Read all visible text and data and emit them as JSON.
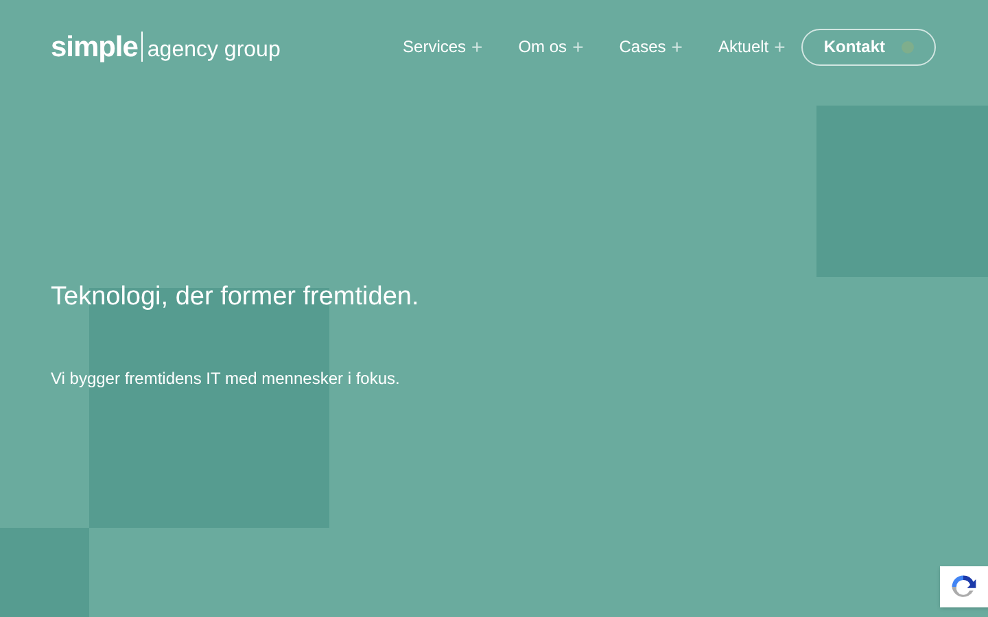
{
  "logo": {
    "primary": "simple",
    "secondary": "agency group"
  },
  "nav": [
    {
      "label": "Services",
      "symbol": "+"
    },
    {
      "label": "Om os",
      "symbol": "+"
    },
    {
      "label": "Cases",
      "symbol": "+"
    },
    {
      "label": "Aktuelt",
      "symbol": "+"
    }
  ],
  "contact_button": "Kontakt",
  "hero": {
    "title": "Teknologi, der former fremtiden.",
    "subtitle": "Vi bygger fremtidens IT med mennesker i fokus."
  }
}
